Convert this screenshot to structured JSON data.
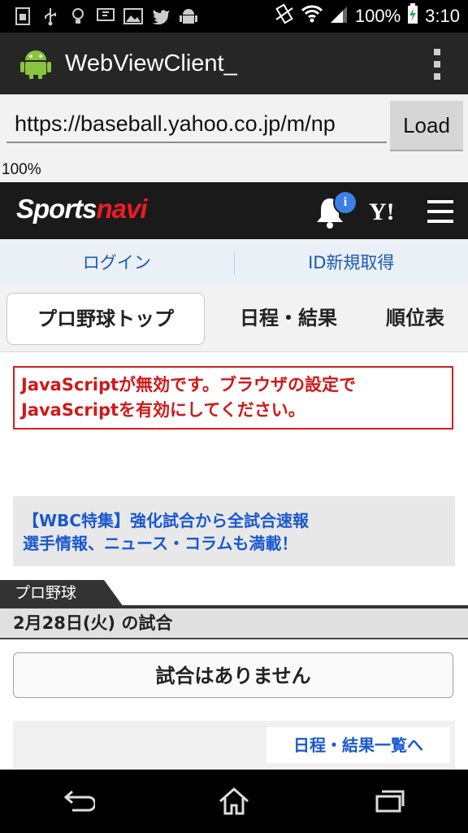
{
  "status_bar": {
    "battery_text": "100%",
    "time": "3:10"
  },
  "action_bar": {
    "title": "WebViewClient_"
  },
  "url_bar": {
    "url_value": "https://baseball.yahoo.co.jp/m/np",
    "load_label": "Load",
    "progress_text": "100%"
  },
  "site_header": {
    "logo_part1": "Sports",
    "logo_part2": "navi",
    "notification_badge": "i",
    "yahoo_logo": "Y!"
  },
  "login_bar": {
    "login_label": "ログイン",
    "register_label": "ID新規取得"
  },
  "tabs": [
    {
      "label": "プロ野球トップ",
      "active": true
    },
    {
      "label": "日程・結果",
      "active": false
    },
    {
      "label": "順位表",
      "active": false
    }
  ],
  "warning": {
    "line1": "JavaScriptが無効です。ブラウザの設定で",
    "line2": "JavaScriptを有効にしてください。"
  },
  "banner": {
    "line1": "【WBC特集】強化試合から全試合速報",
    "line2": "選手情報、ニュース・コラムも満載！"
  },
  "section": {
    "category": "プロ野球",
    "date_heading": "2月28日(火) の試合",
    "no_games": "試合はありません",
    "schedule_link": "日程・結果一覧へ"
  },
  "colors": {
    "brand_red": "#ec1c24",
    "link_blue": "#1a58b6",
    "warning_red": "#d01818"
  }
}
